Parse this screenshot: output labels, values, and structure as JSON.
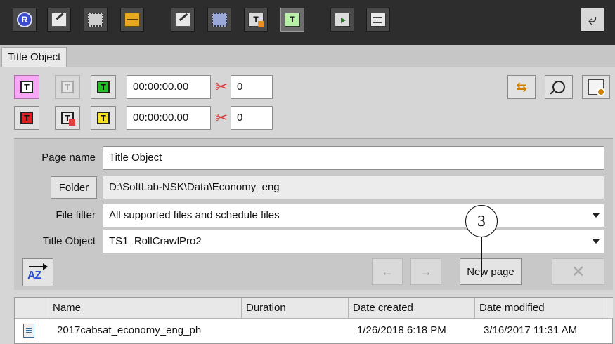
{
  "toolbar": {
    "buttons": [
      {
        "name": "r-logo-icon"
      },
      {
        "name": "edit-clip-icon"
      },
      {
        "name": "film-strip-icon"
      },
      {
        "name": "timeline-icon"
      },
      {
        "name": "edit-video-icon"
      },
      {
        "name": "video-settings-icon"
      },
      {
        "name": "title-text-icon"
      },
      {
        "name": "title-object-icon",
        "active": true
      },
      {
        "name": "export-icon"
      },
      {
        "name": "document-icon"
      }
    ],
    "right_icon": "undo-arrow-icon"
  },
  "tab": {
    "title": "Title Object"
  },
  "row1": {
    "time": "00:00:00.00",
    "count": "0"
  },
  "row2": {
    "time": "00:00:00.00",
    "count": "0"
  },
  "form": {
    "page_name_label": "Page name",
    "page_name_value": "Title Object",
    "folder_button": "Folder",
    "folder_value": "D:\\SoftLab-NSK\\Data\\Economy_eng",
    "file_filter_label": "File filter",
    "file_filter_value": "All supported files and schedule files",
    "title_object_label": "Title Object",
    "title_object_value": "TS1_RollCrawlPro2",
    "sort_label": "AZ",
    "new_page_button": "New page"
  },
  "callout": {
    "number": "3"
  },
  "table": {
    "columns": [
      "Name",
      "Duration",
      "Date created",
      "Date modified"
    ],
    "rows": [
      {
        "name": "2017cabsat_economy_eng_ph",
        "duration": "",
        "created": "1/26/2018 6:18 PM",
        "modified": "3/16/2017 11:31 AM"
      }
    ]
  },
  "colors": {
    "accent_pink": "#f6a8f4",
    "toolbar_bg": "#2d2d2d",
    "x_red": "#d8403c"
  }
}
